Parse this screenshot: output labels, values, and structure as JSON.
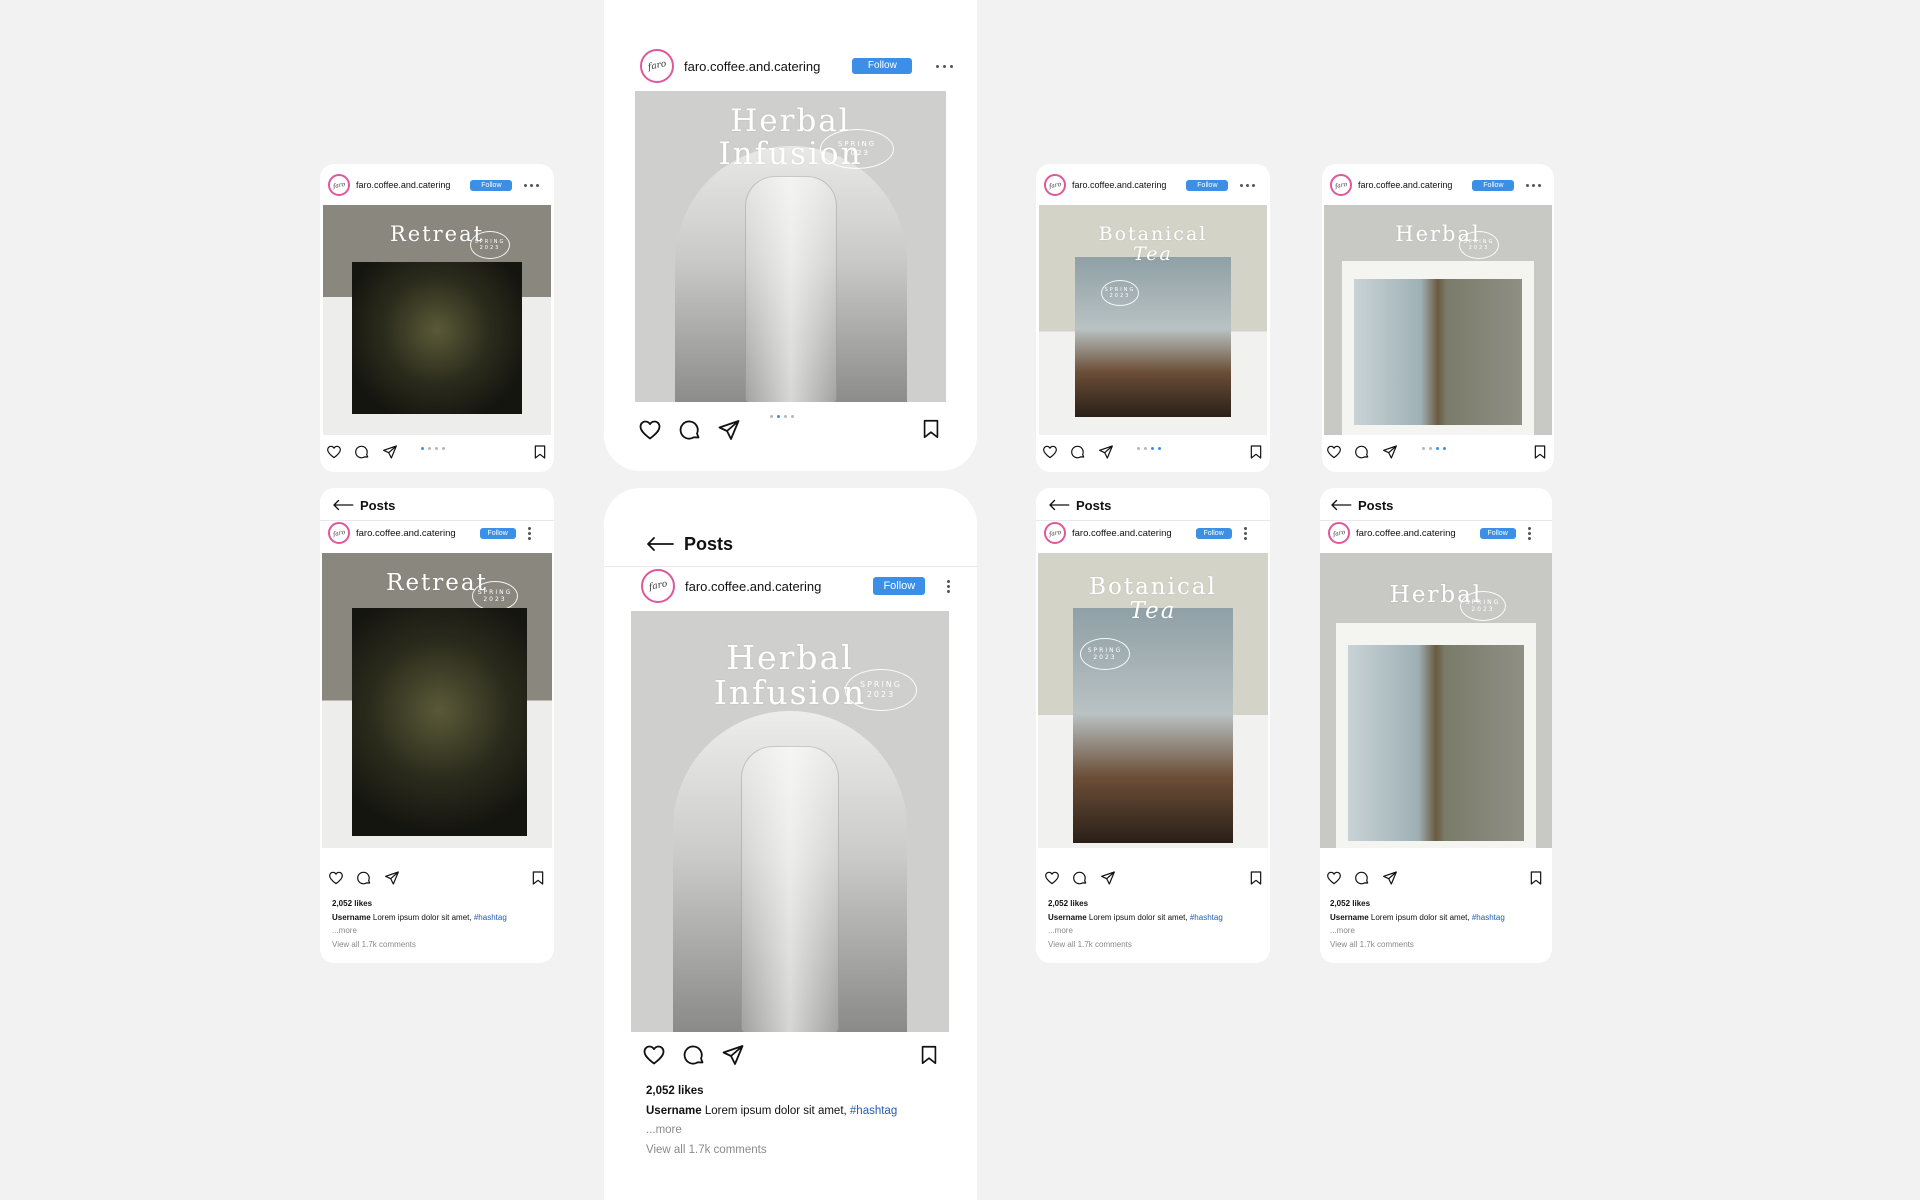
{
  "account": {
    "username": "faro.coffee.and.catering",
    "avatar_text": "faro",
    "follow_label": "Follow"
  },
  "nav": {
    "back_label": "Posts"
  },
  "posts": {
    "retreat": {
      "title": "Retreat",
      "badge_line1": "SPRING",
      "badge_line2": "2023"
    },
    "herbal_infusion": {
      "line1": "Herbal",
      "line2": "Infusion",
      "badge_line1": "SPRING",
      "badge_line2": "2023"
    },
    "botanical_tea": {
      "line1": "Botanical",
      "line2": "Tea",
      "badge_line1": "SPRING",
      "badge_line2": "2023"
    },
    "herbal": {
      "title": "Herbal",
      "badge_line1": "SPRING",
      "badge_line2": "2023"
    }
  },
  "caption": {
    "likes": "2,052 likes",
    "username": "Username",
    "text": " Lorem ipsum dolor sit amet, ",
    "hashtag": "#hashtag",
    "more": "...more",
    "comments": "View all 1.7k comments"
  },
  "carousel": {
    "pages": 4
  },
  "icons": {
    "heart": "heart-icon",
    "comment": "comment-icon",
    "share": "share-icon",
    "bookmark": "bookmark-icon",
    "back": "back-arrow-icon",
    "more": "more-options-icon"
  },
  "colors": {
    "accent": "#3b8fe7",
    "background": "#f2f2f2",
    "avatar_ring": "#e0579b",
    "hashtag": "#1f5fae"
  }
}
